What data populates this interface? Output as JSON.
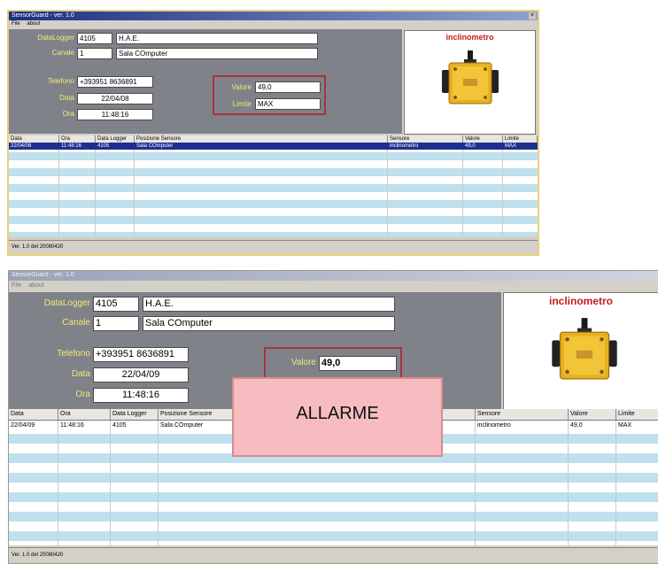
{
  "window1": {
    "title": "SensorGuard - ver. 1.0",
    "menu": [
      "File",
      "about"
    ],
    "form": {
      "datalogger_label": "DataLogger",
      "datalogger_id": "4105",
      "datalogger_name": "H.A.E.",
      "canale_label": "Canale",
      "canale_num": "1",
      "canale_name": "Sala COmputer",
      "telefono_label": "Telefono",
      "telefono_value": "+393951 8636891",
      "data_label": "Data",
      "data_value": "22/04/08",
      "ora_label": "Ora",
      "ora_value": "11:48:16",
      "valore_label": "Valore",
      "valore_value": "49,0",
      "limite_label": "Limite",
      "limite_value": "MAX"
    },
    "picture_title": "inclinometro",
    "table": {
      "headers": [
        "Data",
        "Ora",
        "Data Logger",
        "Posizione Sensore",
        "Sensore",
        "Valore",
        "Limite"
      ],
      "rows": [
        [
          "22/04/08",
          "11:48:16",
          "4105",
          "Sala COmputer",
          "inclinometro",
          "49,0",
          "MAX"
        ]
      ]
    },
    "status": "Ver. 1.0 del 20080420"
  },
  "window2": {
    "title": "SensorGuard - ver. 1.0",
    "menu": [
      "File",
      "about"
    ],
    "form": {
      "datalogger_label": "DataLogger",
      "datalogger_id": "4105",
      "datalogger_name": "H.A.E.",
      "canale_label": "Canale",
      "canale_num": "1",
      "canale_name": "Sala COmputer",
      "telefono_label": "Telefono",
      "telefono_value": "+393951 8636891",
      "data_label": "Data",
      "data_value": "22/04/09",
      "ora_label": "Ora",
      "ora_value": "11:48:16",
      "valore_label": "Valore",
      "valore_value": "49,0"
    },
    "picture_title": "inclinometro",
    "table": {
      "headers": [
        "Data",
        "Ora",
        "Data Logger",
        "Posizione Sensore",
        "Sensore",
        "Valore",
        "Limite"
      ],
      "rows": [
        [
          "22/04/09",
          "11:48:16",
          "4105",
          "Sala COmputer",
          "inclinometro",
          "49,0",
          "MAX"
        ]
      ]
    },
    "alarm_text": "ALLARME",
    "status": "Ver. 1.0 del 20080420"
  },
  "colors": {
    "label_yellow": "#f2e87a",
    "panel_gray": "#7f8288",
    "stripe_blue": "#bfe0ee",
    "alarm_pink": "#f6bcc0",
    "title_red": "#c01c1c"
  }
}
